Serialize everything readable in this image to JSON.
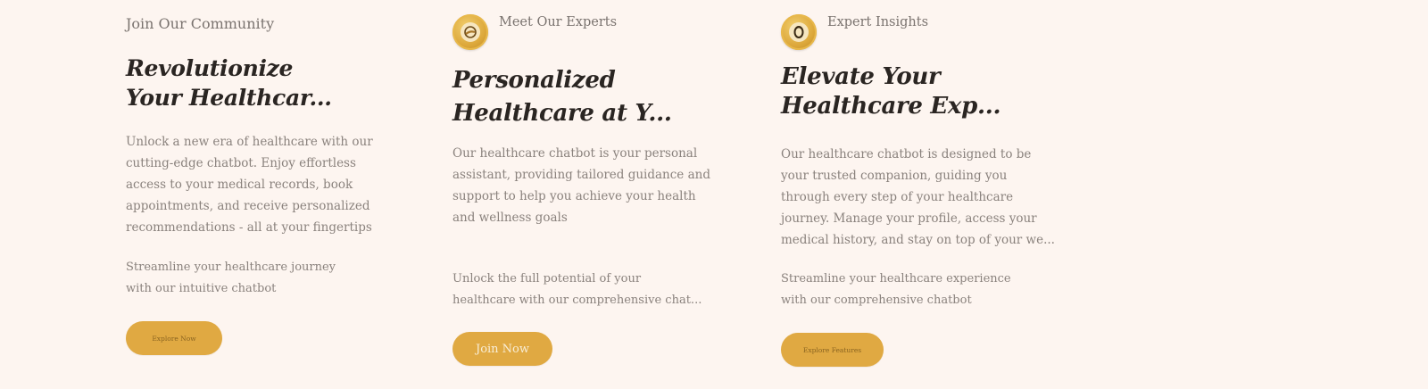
{
  "cards": [
    {
      "eyebrow": "Join Our Community",
      "headline_line1": "Revolutionize",
      "headline_line2": "Your Healthcar...",
      "body": "Unlock a new era of healthcare with our cutting-edge chatbot. Enjoy effortless access to your medical records, book appointments, and receive personalized recommendations - all at your fingertips",
      "sub": "Streamline your healthcare journey with our intuitive chatbot",
      "button": "Explore Now"
    },
    {
      "eyebrow": "Meet Our Experts",
      "avatar_icon": "expert-avatar-icon",
      "headline_line1": "Personalized",
      "headline_line2": "Healthcare at Y...",
      "body": "Our healthcare chatbot is your personal assistant, providing tailored guidance and support to help you achieve your health and wellness goals",
      "sub": "Unlock the full potential of your healthcare with our comprehensive chat...",
      "button": "Join Now"
    },
    {
      "eyebrow": "Expert Insights",
      "avatar_icon": "insights-avatar-icon",
      "headline_line1": "Elevate Your",
      "headline_line2": "Healthcare Exp...",
      "body": "Our healthcare chatbot is designed to be your trusted companion, guiding you through every step of your healthcare journey. Manage your profile, access your medical history, and stay on top of your we...",
      "sub": "Streamline your healthcare experience with our comprehensive chatbot",
      "button": "Explore Features"
    }
  ],
  "colors": {
    "background": "#fdf5f0",
    "accent": "#e0a942",
    "heading": "#2a2522",
    "body_text": "#8a827d"
  }
}
